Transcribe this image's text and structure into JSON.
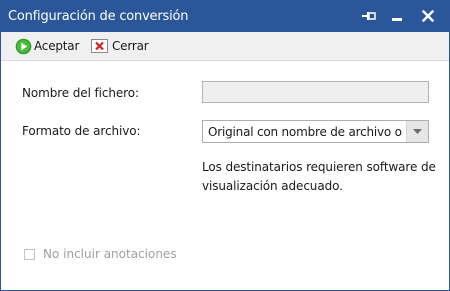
{
  "window": {
    "title": "Configuración de conversión",
    "colors": {
      "titlebar": "#2b579a",
      "toolbar": "#f0f0f0"
    },
    "controls": [
      "pin-icon",
      "minimize-icon",
      "close-icon"
    ]
  },
  "toolbar": {
    "accept_label": "Aceptar",
    "accept_icon": "play-circle-icon",
    "close_label": "Cerrar",
    "close_icon": "close-x-icon"
  },
  "form": {
    "filename_label": "Nombre del fichero:",
    "filename_value": "",
    "format_label": "Formato de archivo:",
    "format_value": "Original con nombre de archivo original",
    "info_text": "Los destinatarios requieren software de visualización adecuado.",
    "no_annotations_label": "No incluir anotaciones",
    "no_annotations_checked": false,
    "no_annotations_enabled": false
  }
}
